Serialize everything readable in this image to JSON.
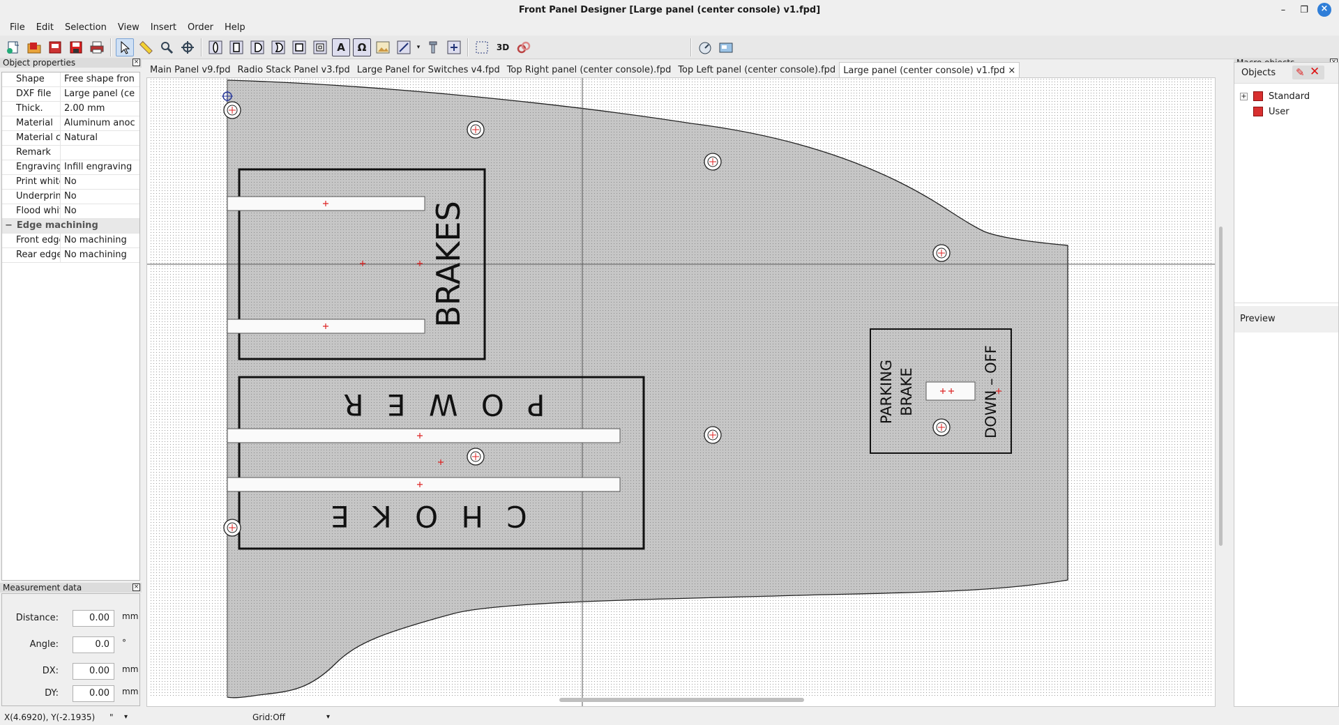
{
  "window": {
    "title": "Front Panel Designer [Large panel (center console) v1.fpd]",
    "minimize": "–",
    "restore": "❐",
    "close": "×"
  },
  "menu": [
    "File",
    "Edit",
    "Selection",
    "View",
    "Insert",
    "Order",
    "Help"
  ],
  "toolbar": {
    "buttons": [
      "new-icon",
      "open-icon",
      "export-icon",
      "save-icon",
      "print-icon",
      "pointer-icon",
      "ruler-icon",
      "zoom-icon",
      "crosshair-icon",
      "hole-icon",
      "rect-hole-icon",
      "d-hole-icon",
      "double-d-icon",
      "rect-pocket-icon",
      "cavity-icon",
      "text-icon",
      "engrave-icon",
      "picture-icon",
      "line-icon",
      "bolt-icon",
      "bolt-stud-icon",
      "select-rect-icon",
      "3d-icon",
      "chain-icon",
      "price-icon",
      "preview-icon"
    ],
    "text_label": "A",
    "engrave_label": "Ω",
    "three_d_label": "3D"
  },
  "object_properties": {
    "title": "Object properties",
    "rows": [
      {
        "key": "Shape",
        "value": "Free shape fron"
      },
      {
        "key": "DXF file",
        "value": "Large panel (ce"
      },
      {
        "key": "Thick.",
        "value": "2.00 mm"
      },
      {
        "key": "Material",
        "value": "Aluminum anoc"
      },
      {
        "key": "Material colc",
        "value": "Natural"
      },
      {
        "key": "Remark",
        "value": ""
      },
      {
        "key": "Engraving m",
        "value": "Infill engraving"
      },
      {
        "key": "Print white",
        "value": "No"
      },
      {
        "key": "Underprint w",
        "value": "No"
      },
      {
        "key": "Flood white",
        "value": "No"
      }
    ],
    "group": {
      "toggle": "−",
      "label": "Edge machining"
    },
    "group_rows": [
      {
        "key": "Front edges",
        "value": "No machining"
      },
      {
        "key": "Rear edges",
        "value": "No machining"
      }
    ]
  },
  "measurement": {
    "title": "Measurement data",
    "distance": {
      "label": "Distance:",
      "value": "0.00",
      "unit": "mm"
    },
    "angle": {
      "label": "Angle:",
      "value": "0.0",
      "unit": "°"
    },
    "dx": {
      "label": "DX:",
      "value": "0.00",
      "unit": "mm"
    },
    "dy": {
      "label": "DY:",
      "value": "0.00",
      "unit": "mm"
    }
  },
  "tabs": [
    "Main Panel v9.fpd",
    "Radio Stack Panel v3.fpd",
    "Large Panel for Switches v4.fpd",
    "Top Right panel (center console).fpd",
    "Top Left panel (center console).fpd",
    "Large panel (center console) v1.fpd"
  ],
  "tab_close": "×",
  "canvas": {
    "brakes_label": "BRAKES",
    "power_label": "P O W E R",
    "choke_label": "C H O K E",
    "parking_line1": "PARKING",
    "parking_line2": "BRAKE",
    "down_off_label": "DOWN – OFF",
    "panel_color": "#c6c6c6"
  },
  "macro": {
    "title": "Macro objects",
    "objects_label": "Objects",
    "tree": [
      {
        "label": "Standard",
        "expander": "+"
      },
      {
        "label": "User",
        "expander": ""
      }
    ],
    "preview_label": "Preview"
  },
  "status": {
    "coords": "X(4.6920), Y(-2.1935)",
    "unit": "\"",
    "grid": "Grid:Off"
  }
}
